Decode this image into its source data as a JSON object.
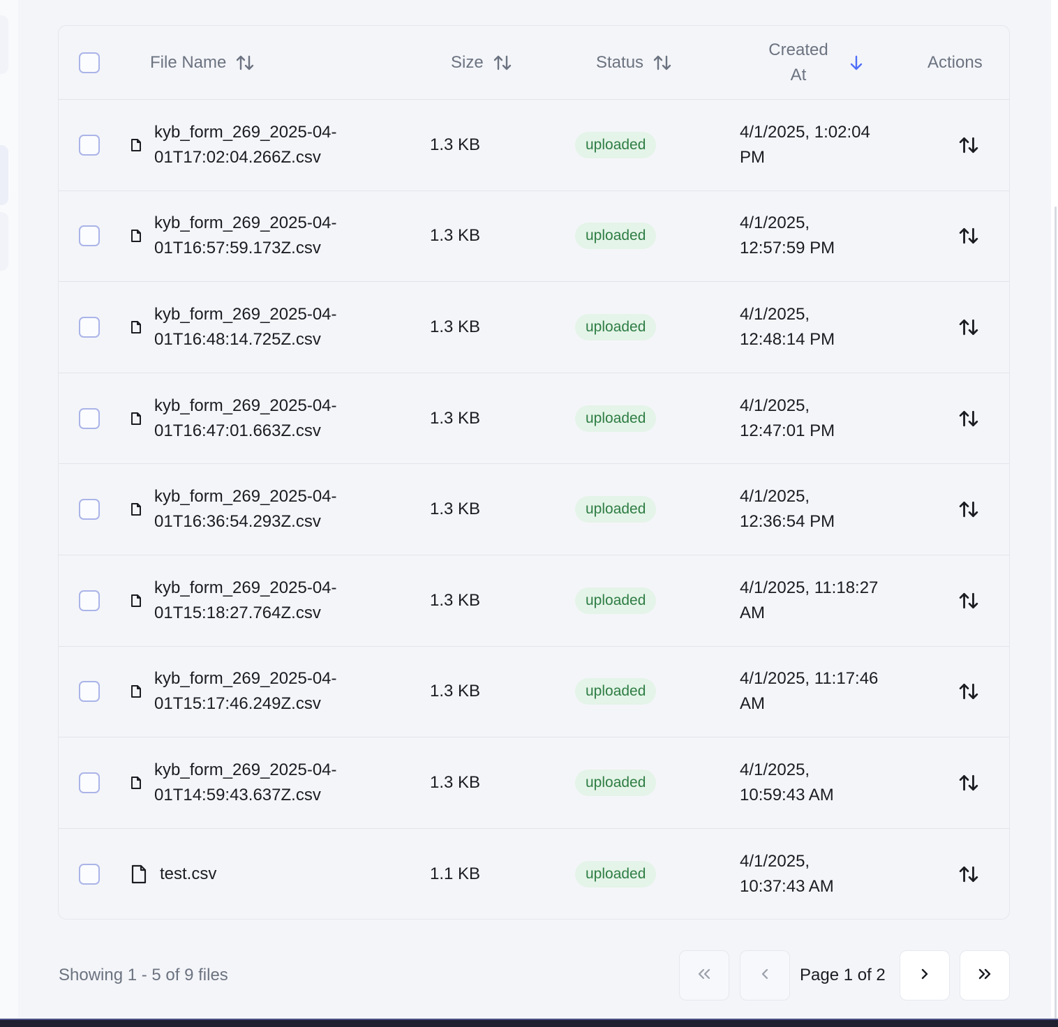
{
  "table": {
    "headers": {
      "file_name": "File Name",
      "size": "Size",
      "status": "Status",
      "created_at_line1": "Created",
      "created_at_line2": "At",
      "actions": "Actions"
    },
    "sort_state": {
      "created_at": "descending"
    },
    "rows": [
      {
        "name_line1": "kyb_form_269_2025-04-",
        "name_line2": "01T17:02:04.266Z.csv",
        "size": "1.3 KB",
        "status": "uploaded",
        "created_line1": "4/1/2025, 1:02:04",
        "created_line2": "PM"
      },
      {
        "name_line1": "kyb_form_269_2025-04-",
        "name_line2": "01T16:57:59.173Z.csv",
        "size": "1.3 KB",
        "status": "uploaded",
        "created_line1": "4/1/2025,",
        "created_line2": "12:57:59 PM"
      },
      {
        "name_line1": "kyb_form_269_2025-04-",
        "name_line2": "01T16:48:14.725Z.csv",
        "size": "1.3 KB",
        "status": "uploaded",
        "created_line1": "4/1/2025,",
        "created_line2": "12:48:14 PM"
      },
      {
        "name_line1": "kyb_form_269_2025-04-",
        "name_line2": "01T16:47:01.663Z.csv",
        "size": "1.3 KB",
        "status": "uploaded",
        "created_line1": "4/1/2025,",
        "created_line2": "12:47:01 PM"
      },
      {
        "name_line1": "kyb_form_269_2025-04-",
        "name_line2": "01T16:36:54.293Z.csv",
        "size": "1.3 KB",
        "status": "uploaded",
        "created_line1": "4/1/2025,",
        "created_line2": "12:36:54 PM"
      },
      {
        "name_line1": "kyb_form_269_2025-04-",
        "name_line2": "01T15:18:27.764Z.csv",
        "size": "1.3 KB",
        "status": "uploaded",
        "created_line1": "4/1/2025, 11:18:27",
        "created_line2": "AM"
      },
      {
        "name_line1": "kyb_form_269_2025-04-",
        "name_line2": "01T15:17:46.249Z.csv",
        "size": "1.3 KB",
        "status": "uploaded",
        "created_line1": "4/1/2025, 11:17:46",
        "created_line2": "AM"
      },
      {
        "name_line1": "kyb_form_269_2025-04-",
        "name_line2": "01T14:59:43.637Z.csv",
        "size": "1.3 KB",
        "status": "uploaded",
        "created_line1": "4/1/2025,",
        "created_line2": "10:59:43 AM"
      },
      {
        "name_line1": "test.csv",
        "name_line2": "",
        "size": "1.1 KB",
        "status": "uploaded",
        "created_line1": "4/1/2025,",
        "created_line2": "10:37:43 AM"
      }
    ]
  },
  "footer": {
    "showing_text": "Showing 1 - 5 of 9 files",
    "page_label": "Page 1 of 2"
  },
  "icons": {
    "sort": "sort-arrows-icon",
    "sort_desc": "arrow-down-icon",
    "file": "file-icon",
    "first_page": "double-chevron-left-icon",
    "prev_page": "chevron-left-icon",
    "next_page": "chevron-right-icon",
    "last_page": "double-chevron-right-icon"
  },
  "colors": {
    "accent": "#4f6ef7",
    "badge_bg": "#e4f4e8",
    "badge_text": "#2e7d44",
    "muted_text": "#6b7380"
  }
}
